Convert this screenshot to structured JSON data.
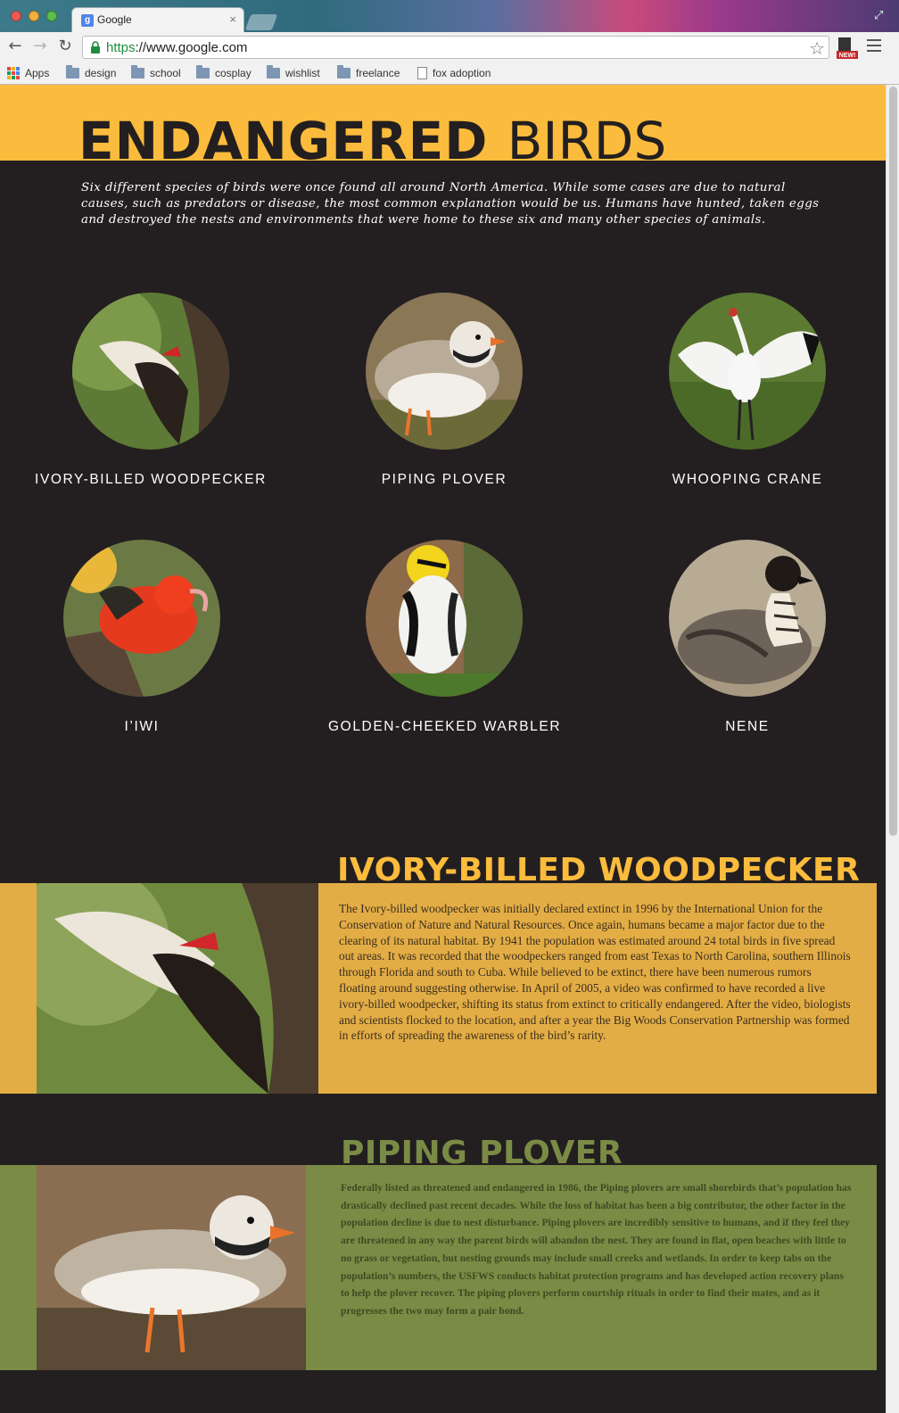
{
  "browser": {
    "tab_title": "Google",
    "tab_favicon": "g",
    "tab_close": "×",
    "url_scheme": "https",
    "url_rest": "://www.google.com",
    "bookmarks": [
      "Apps",
      "design",
      "school",
      "cosplay",
      "wishlist",
      "freelance",
      "fox adoption"
    ],
    "extension_badge": "NEW!"
  },
  "hero": {
    "title_bold": "ENDANGERED",
    "title_light": "BIRDS",
    "intro": "Six different species of birds were once found all around North America. While some cases are due to natural causes, such as predators or disease, the most common explanation would be us. Humans have hunted, taken eggs and destroyed the nests and environments that were home to these six and many other species of animals."
  },
  "birds": [
    {
      "name": "IVORY-BILLED WOODPECKER"
    },
    {
      "name": "PIPING PLOVER"
    },
    {
      "name": "WHOOPING CRANE"
    },
    {
      "name": "I’IWI"
    },
    {
      "name": "GOLDEN-CHEEKED WARBLER"
    },
    {
      "name": "NENE"
    }
  ],
  "sections": [
    {
      "title": "IVORY-BILLED WOODPECKER",
      "body": "The Ivory-billed woodpecker was initially declared extinct in 1996 by the International Union for the Conservation of Nature and Natural Resources. Once again, humans became a major factor due to the clearing of its natural habitat. By 1941 the population was estimated around 24 total birds in five spread out areas. It was recorded that the woodpeckers ranged from east Texas to North Carolina, southern Illinois through Florida and south to Cuba. While believed to be extinct, there have been numerous rumors floating around suggesting otherwise. In April of 2005, a video was confirmed to have recorded a live ivory-billed woodpecker, shifting its status from extinct to critically endangered. After the video, biologists and scientists flocked to the location, and after a year the Big Woods Conservation Partnership was formed in efforts of spreading the awareness of the bird’s rarity.",
      "title_color": "#fbbb3c",
      "band_color": "#e3ad45",
      "text_color": "#3a2e1e"
    },
    {
      "title": "PIPING PLOVER",
      "body": "Federally listed as threatened and endangered in 1986, the Piping plovers are small shorebirds that’s population has drastically declined past recent decades. While the loss of habitat has been a big contributor, the other factor in the population decline is due to nest disturbance. Piping plovers are incredibly sensitive to humans, and if they feel they are threatened in any way the parent birds will abandon the nest. They are found in flat, open beaches with little to no grass or vegetation, but nesting grounds may include small creeks and wetlands. In order to keep tabs on the population’s numbers, the USFWS conducts habitat protection programs and has developed action recovery plans to help the plover recover. The piping plovers perform courtship rituals in order to find their mates, and as it progresses the two may form a pair bond.",
      "title_color": "#7a8b45",
      "band_color": "#7a8b45",
      "text_color": "#3e4a22"
    }
  ]
}
